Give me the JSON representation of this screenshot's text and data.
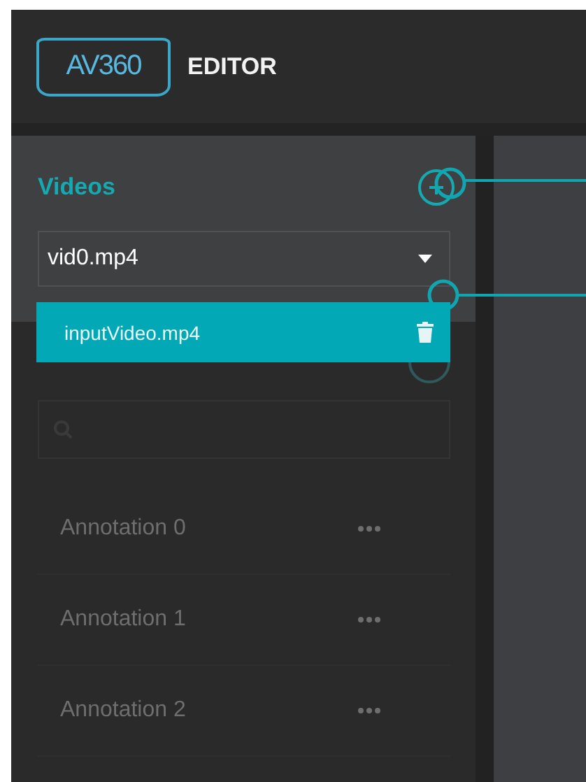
{
  "header": {
    "logo": "AV360",
    "title": "EDITOR"
  },
  "videos": {
    "title": "Videos",
    "dropdown": {
      "value": "vid0.mp4",
      "expanded": true,
      "options": [
        {
          "label": "inputVideo.mp4"
        }
      ]
    }
  },
  "annotations": {
    "items": [
      {
        "label": "Annotation 0"
      },
      {
        "label": "Annotation 1"
      },
      {
        "label": "Annotation 2"
      }
    ]
  }
}
